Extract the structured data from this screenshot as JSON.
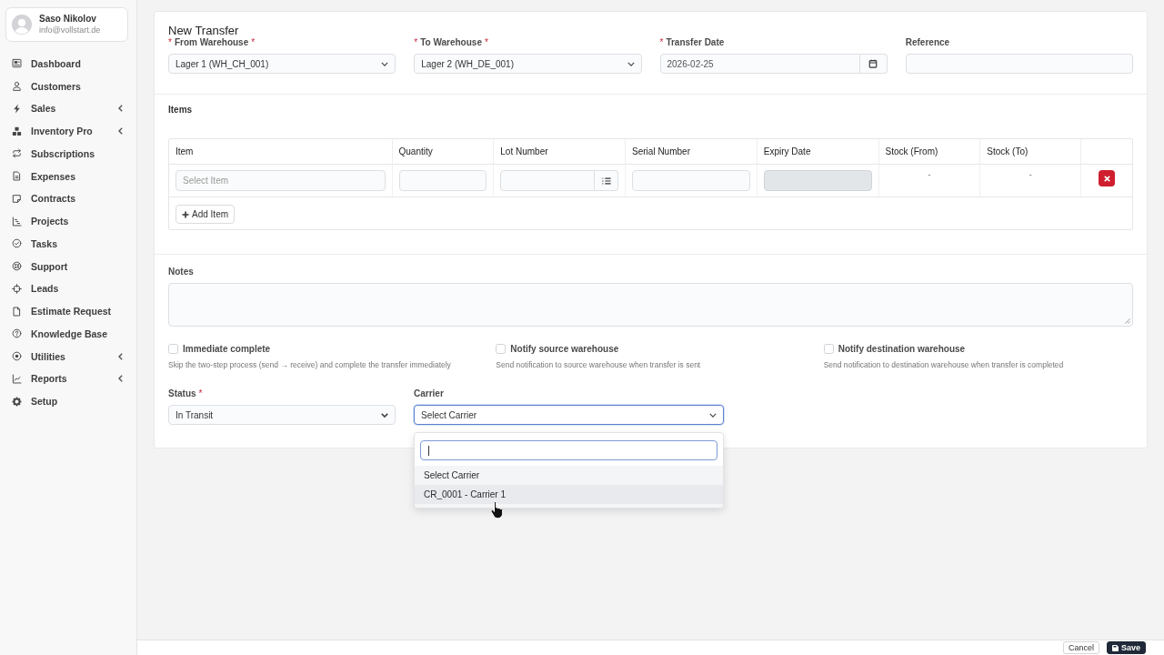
{
  "sidebar": {
    "user": {
      "name": "Saso Nikolov",
      "email": "info@vollstart.de"
    },
    "items": [
      {
        "label": "Dashboard",
        "expandable": false
      },
      {
        "label": "Customers",
        "expandable": false
      },
      {
        "label": "Sales",
        "expandable": true
      },
      {
        "label": "Inventory Pro",
        "expandable": true
      },
      {
        "label": "Subscriptions",
        "expandable": false
      },
      {
        "label": "Expenses",
        "expandable": false
      },
      {
        "label": "Contracts",
        "expandable": false
      },
      {
        "label": "Projects",
        "expandable": false
      },
      {
        "label": "Tasks",
        "expandable": false
      },
      {
        "label": "Support",
        "expandable": false
      },
      {
        "label": "Leads",
        "expandable": false
      },
      {
        "label": "Estimate Request",
        "expandable": false
      },
      {
        "label": "Knowledge Base",
        "expandable": false
      },
      {
        "label": "Utilities",
        "expandable": true
      },
      {
        "label": "Reports",
        "expandable": true
      },
      {
        "label": "Setup",
        "expandable": false
      }
    ]
  },
  "form": {
    "title": "New Transfer",
    "header_fields": [
      {
        "kind": "select",
        "label": "From Warehouse",
        "mark_before": "*",
        "mark_after": "*",
        "value": "Lager 1 (WH_CH_001)"
      },
      {
        "kind": "select",
        "label": "To Warehouse",
        "mark_before": "*",
        "mark_after": "*",
        "value": "Lager 2 (WH_DE_001)"
      },
      {
        "kind": "date",
        "label": "Transfer Date",
        "mark_before": "*",
        "value": "2026-02-25"
      },
      {
        "kind": "text",
        "label": "Reference"
      }
    ],
    "items": {
      "label": "Items",
      "columns": [
        "Item",
        "Quantity",
        "Lot Number",
        "Serial Number",
        "Expiry Date",
        "Stock (From)",
        "Stock (To)"
      ],
      "rows": [
        {
          "cells": [
            {
              "kind": "select",
              "placeholder": "Select Item",
              "disabled": false
            },
            {
              "kind": "input",
              "disabled": false
            },
            {
              "kind": "lookup",
              "disabled": false
            },
            {
              "kind": "input",
              "disabled": false
            },
            {
              "kind": "input",
              "disabled": true
            },
            {
              "kind": "text",
              "text": "-"
            },
            {
              "kind": "text",
              "text": "-"
            },
            {
              "kind": "delete"
            }
          ]
        }
      ],
      "add_button": "Add Item"
    },
    "notes": {
      "label": "Notes"
    },
    "checkboxes": [
      {
        "label": "Immediate complete",
        "description": "Skip the two-step process (send → receive) and complete the transfer immediately",
        "checked": false
      },
      {
        "label": "Notify source warehouse",
        "description": "Send notification to source warehouse when transfer is sent",
        "checked": false
      },
      {
        "label": "Notify destination warehouse",
        "description": "Send notification to destination warehouse when transfer is completed",
        "checked": false
      }
    ],
    "status": {
      "label": "Status",
      "mark_after": "*",
      "value": "In Transit"
    },
    "carrier": {
      "label": "Carrier",
      "value": "Select Carrier",
      "expanded": true,
      "options": [
        {
          "label": "Select Carrier",
          "highlighted": false
        },
        {
          "label": "CR_0001 - Carrier 1",
          "highlighted": true
        }
      ]
    }
  },
  "footer": {
    "buttons": [
      {
        "kind": "secondary",
        "label": "Cancel"
      },
      {
        "kind": "primary",
        "label": "Save"
      }
    ]
  }
}
